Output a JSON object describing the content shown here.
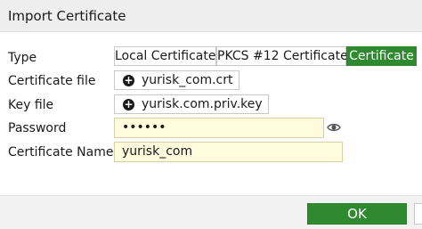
{
  "dialog": {
    "title": "Import Certificate"
  },
  "form": {
    "type": {
      "label": "Type",
      "options": [
        "Local Certificate",
        "PKCS #12 Certificate",
        "Certificate"
      ],
      "selected": "Certificate"
    },
    "certificate_file": {
      "label": "Certificate file",
      "value": "yurisk_com.crt",
      "icon": "plus-circle-icon"
    },
    "key_file": {
      "label": "Key file",
      "value": "yurisk.com.priv.key",
      "icon": "plus-circle-icon"
    },
    "password": {
      "label": "Password",
      "value": "••••••",
      "toggle_icon": "eye-icon"
    },
    "certificate_name": {
      "label": "Certificate Name",
      "value": "yurisk_com"
    }
  },
  "footer": {
    "ok_label": "OK"
  },
  "colors": {
    "accent": "#2f8a2f",
    "input_bg": "#fffbdc",
    "header_bg": "#eeeeee"
  }
}
